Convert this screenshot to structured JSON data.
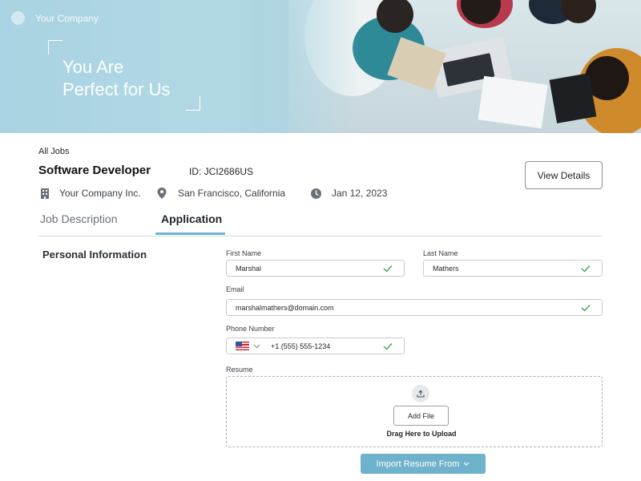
{
  "brand": {
    "name": "Your Company"
  },
  "hero": {
    "line1": "You Are",
    "line2": "Perfect for Us"
  },
  "job": {
    "back_link": "All Jobs",
    "title": "Software Developer",
    "id_text": "ID: JCI2686US",
    "view_details_label": "View Details",
    "company": "Your Company Inc.",
    "location": "San Francisco, California",
    "date": "Jan 12, 2023"
  },
  "tabs": [
    {
      "label": "Job Description",
      "active": false
    },
    {
      "label": "Application",
      "active": true
    }
  ],
  "form": {
    "section_title": "Personal Information",
    "first_name": {
      "label": "First Name",
      "value": "Marshal"
    },
    "last_name": {
      "label": "Last Name",
      "value": "Mathers"
    },
    "email": {
      "label": "Email",
      "value": "marshalmathers@domain.com"
    },
    "phone": {
      "label": "Phone Number",
      "value": "+1 (555) 555-1234",
      "country_icon": "us-flag-icon"
    },
    "resume": {
      "label": "Resume",
      "add_file_label": "Add File",
      "drag_text": "Drag Here to Upload"
    },
    "import_label": "Import Resume From"
  },
  "colors": {
    "accent": "#6fb2cc",
    "check": "#3aa84a",
    "hero_bg": "#a9d3e2"
  }
}
